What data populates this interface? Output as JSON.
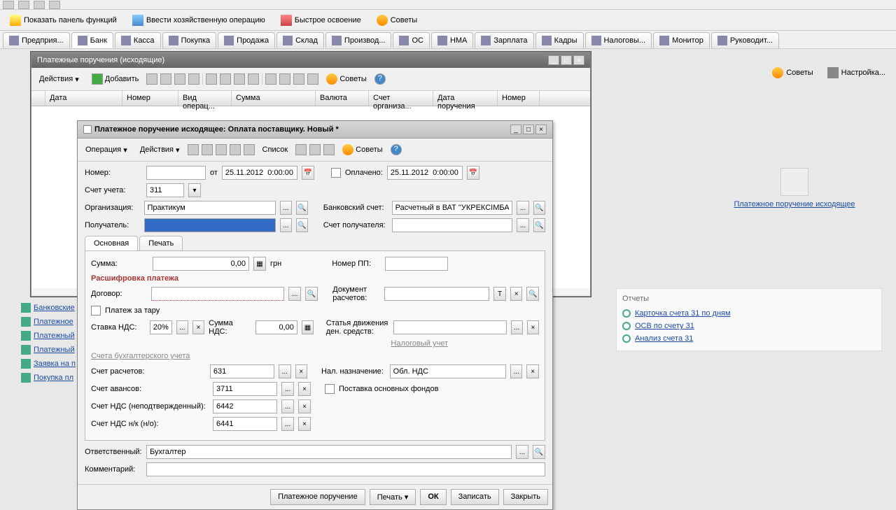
{
  "action_toolbar": {
    "show_panel": "Показать панель функций",
    "enter_op": "Ввести хозяйственную операцию",
    "quick": "Быстрое освоение",
    "tips": "Советы"
  },
  "module_tabs": [
    "Предприя...",
    "Банк",
    "Касса",
    "Покупка",
    "Продажа",
    "Склад",
    "Производ...",
    "ОС",
    "НМА",
    "Зарплата",
    "Кадры",
    "Налоговы...",
    "Монитор",
    "Руководит..."
  ],
  "right_tips": {
    "tips": "Советы",
    "setup": "Настройка..."
  },
  "list_window": {
    "title": "Платежные поручения (исходящие)",
    "toolbar": {
      "actions": "Действия",
      "add": "Добавить",
      "tips": "Советы"
    },
    "columns": [
      "",
      "Дата",
      "Номер",
      "Вид операц...",
      "Сумма",
      "Валюта",
      "Счет организа...",
      "Дата поручения",
      "Номер"
    ]
  },
  "form_window": {
    "title": "Платежное поручение исходящее: Оплата поставщику. Новый *",
    "toolbar": {
      "operation": "Операция",
      "actions": "Действия",
      "list": "Список",
      "tips": "Советы"
    },
    "number_label": "Номер:",
    "from_label": "от",
    "date1": "25.11.2012  0:00:00",
    "paid_label": "Оплачено:",
    "date2": "25.11.2012  0:00:00",
    "account_label": "Счет учета:",
    "account_value": "311",
    "org_label": "Организация:",
    "org_value": "Практикум",
    "bank_label": "Банковский счет:",
    "bank_value": "Расчетный в ВАТ \"УКРЕКСІМБАНК\"",
    "payee_label": "Получатель:",
    "payee_acc_label": "Счет получателя:",
    "tabs": [
      "Основная",
      "Печать"
    ],
    "sum_label": "Сумма:",
    "sum_value": "0,00",
    "currency": "грн",
    "pp_label": "Номер ПП:",
    "breakdown": "Расшифровка платежа",
    "contract_label": "Договор:",
    "doc_label": "Документ расчетов:",
    "tare_label": "Платеж за тару",
    "vat_rate_label": "Ставка НДС:",
    "vat_rate_value": "20%",
    "vat_sum_label": "Сумма НДС:",
    "vat_sum_value": "0,00",
    "flow_label": "Статья движения ден. средств:",
    "tax_section": "Налоговый учет",
    "accounts_section": "Счета бухгалтерского учета",
    "acc1_label": "Счет расчетов:",
    "acc1": "631",
    "acc2_label": "Счет авансов:",
    "acc2": "3711",
    "acc3_label": "Счет НДС (неподтвержденный):",
    "acc3": "6442",
    "acc4_label": "Счет НДС н/к (н/о):",
    "acc4": "6441",
    "vat_purpose_label": "Нал. назначение:",
    "vat_purpose": "Обл. НДС",
    "supply_label": "Поставка основных фондов",
    "resp_label": "Ответственный:",
    "resp": "Бухгалтер",
    "comment_label": "Комментарий:",
    "footer": {
      "print_doc": "Платежное поручение",
      "print": "Печать",
      "ok": "ОК",
      "save": "Записать",
      "close": "Закрыть"
    }
  },
  "side_links": [
    "Банковские",
    "Платежное",
    "Платежный",
    "Платежный",
    "Заявка на п",
    "Покупка пл"
  ],
  "right_panel": {
    "link": "Платежное поручение исходящее"
  },
  "reports": {
    "title": "Отчеты",
    "items": [
      "Карточка счета 31 по дням",
      "ОСВ по счету 31",
      "Анализ счета 31"
    ]
  }
}
